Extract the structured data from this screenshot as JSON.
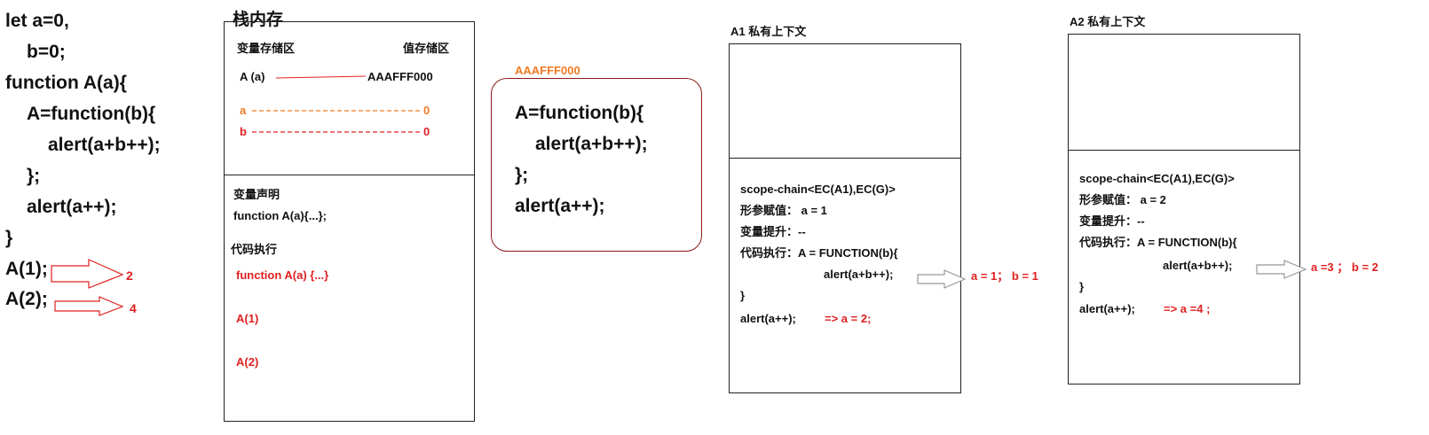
{
  "code": {
    "lines": [
      "let a=0,",
      "b=0;",
      "function A(a){",
      "A=function(b){",
      "alert(a+b++);",
      "};",
      "alert(a++);",
      "}",
      "A(1);",
      "A(2);"
    ],
    "results": [
      "2",
      "4"
    ]
  },
  "stack": {
    "title": "栈内存",
    "var_area_label": "变量存储区",
    "value_area_label": "值存储区",
    "entries": [
      {
        "name": "A  (a)",
        "value": "AAAFFF000"
      },
      {
        "name": "a",
        "value": "0"
      },
      {
        "name": "b",
        "value": "0"
      }
    ],
    "declare_label": "变量声明",
    "declare_text": "function A(a){...};",
    "exec_label": "代码执行",
    "exec_lines": [
      "function A(a) {...}",
      "A(1)",
      "A(2)"
    ]
  },
  "heap": {
    "address": "AAAFFF000",
    "lines": [
      "A=function(b){",
      "alert(a+b++);",
      "};",
      "alert(a++);"
    ]
  },
  "ec_a1": {
    "title": "A1   私有上下文",
    "scope_chain": "scope-chain<EC(A1),EC(G)>",
    "param_line": "形参赋值：  a = 1",
    "hoist_line": "变量提升：--",
    "exec_line": "代码执行：A = FUNCTION(b){",
    "inner_line": "alert(a+b++);",
    "close_line": "}",
    "alert_line": "alert(a++);",
    "alert_result": "=> a = 2;",
    "side_result": "a = 1；  b = 1"
  },
  "ec_a2": {
    "title": "A2   私有上下文",
    "scope_chain": "scope-chain<EC(A1),EC(G)>",
    "param_line": "形参赋值：  a = 2",
    "hoist_line": "变量提升：--",
    "exec_line": "代码执行：A = FUNCTION(b){",
    "inner_line": "alert(a+b++);",
    "close_line": "}",
    "alert_line": "alert(a++);",
    "alert_result": "=> a =4 ;",
    "side_result": "a =3 ；  b = 2"
  },
  "colors": {
    "red": "#e02020",
    "orange": "#f07a22",
    "border": "#222222",
    "arrow_gray": "#999999"
  }
}
